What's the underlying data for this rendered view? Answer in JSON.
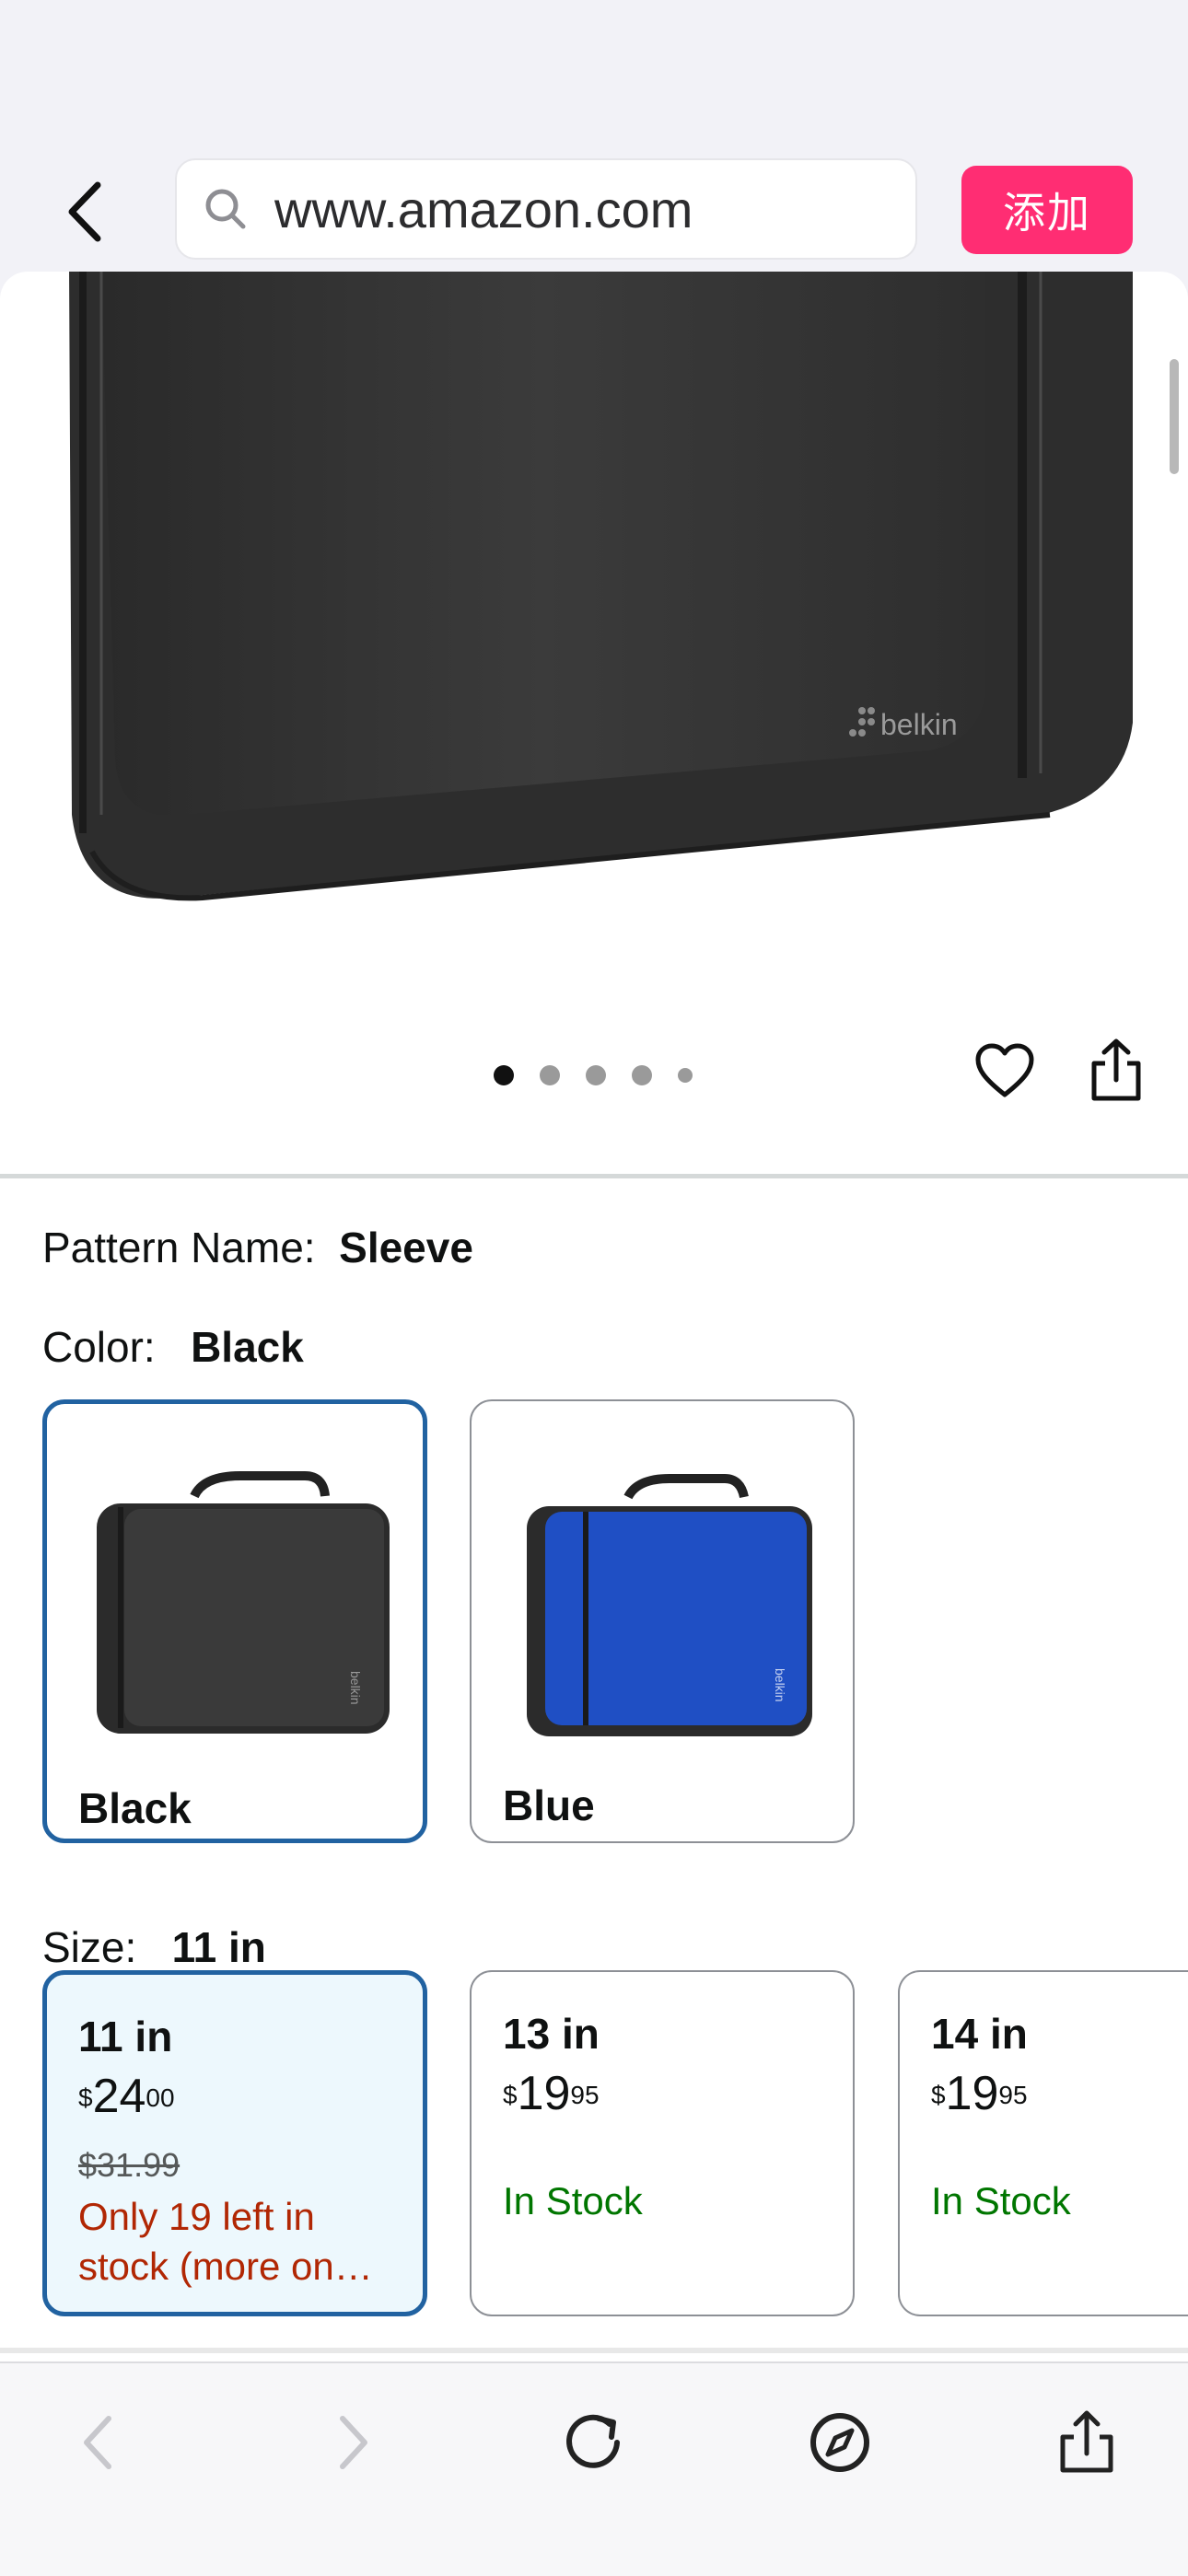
{
  "browser": {
    "url": "www.amazon.com",
    "add_button": "添加",
    "accent_color": "#ff2d73"
  },
  "product": {
    "image_brand_mark": "belkin",
    "image_dots": {
      "count": 5,
      "active_index": 0
    }
  },
  "pattern": {
    "label": "Pattern Name:",
    "value": "Sleeve"
  },
  "color": {
    "label": "Color:",
    "value": "Black",
    "options": [
      {
        "name": "Black",
        "selected": true,
        "swatch_color": "#2b2b2b"
      },
      {
        "name": "Blue",
        "selected": false,
        "swatch_color": "#1f4fc4"
      }
    ]
  },
  "size": {
    "label": "Size:",
    "value": "11 in",
    "options": [
      {
        "name": "11 in",
        "price_dollars": "24",
        "price_cents": "00",
        "list_price": "$31.99",
        "availability": "Only 19 left in stock (more on…",
        "availability_color": "#b12704",
        "selected": true
      },
      {
        "name": "13 in",
        "price_dollars": "19",
        "price_cents": "95",
        "availability": "In Stock",
        "availability_color": "#007600",
        "selected": false
      },
      {
        "name": "14 in",
        "price_dollars": "19",
        "price_cents": "95",
        "availability": "In Stock",
        "availability_color": "#007600",
        "selected": false
      }
    ],
    "currency_symbol": "$"
  },
  "toolbar": {
    "icons": [
      "back-icon",
      "forward-icon",
      "reload-icon",
      "compass-icon",
      "share-icon"
    ]
  }
}
